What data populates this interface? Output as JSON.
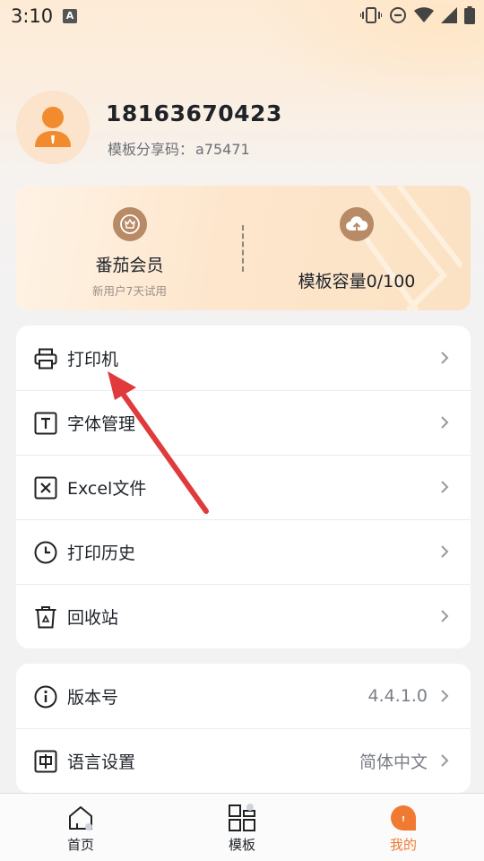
{
  "status_bar": {
    "time": "3:10",
    "notification_badge": "A"
  },
  "profile": {
    "phone": "18163670423",
    "share_code_label": "模板分享码：",
    "share_code": "a75471"
  },
  "vip_card": {
    "member_title": "番茄会员",
    "member_subtitle": "新用户7天试用",
    "capacity_label": "模板容量0/100"
  },
  "menu_main": [
    {
      "label": "打印机",
      "icon": "printer-icon"
    },
    {
      "label": "字体管理",
      "icon": "font-icon"
    },
    {
      "label": "Excel文件",
      "icon": "excel-icon"
    },
    {
      "label": "打印历史",
      "icon": "clock-icon"
    },
    {
      "label": "回收站",
      "icon": "trash-icon"
    }
  ],
  "menu_settings": [
    {
      "label": "版本号",
      "value": "4.4.1.0",
      "icon": "info-icon"
    },
    {
      "label": "语言设置",
      "value": "简体中文",
      "icon": "language-icon"
    }
  ],
  "bottom_nav": [
    {
      "label": "首页",
      "icon": "home-icon",
      "active": false
    },
    {
      "label": "模板",
      "icon": "grid-icon",
      "active": false
    },
    {
      "label": "我的",
      "icon": "profile-icon",
      "active": true
    }
  ],
  "colors": {
    "accent": "#f07a32",
    "annotation_arrow": "#e03a3c",
    "vip_icon": "#b88a66"
  }
}
